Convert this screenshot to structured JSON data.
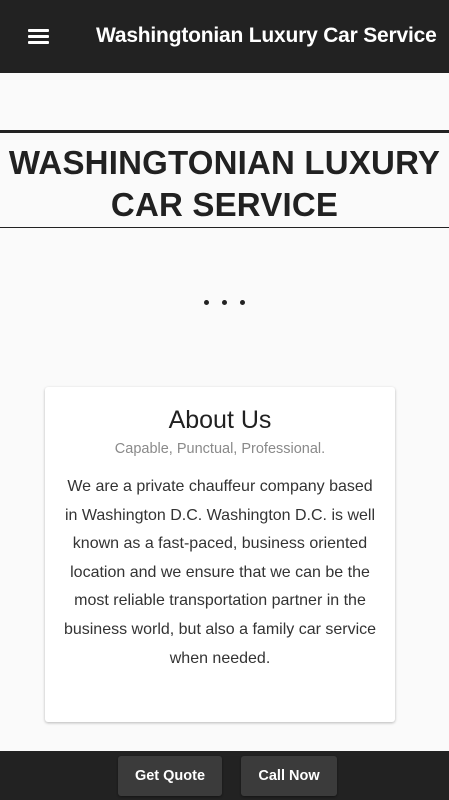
{
  "appbar": {
    "title": "Washingtonian Luxury Car Service",
    "menu_icon": "hamburger-menu-icon"
  },
  "hero": {
    "title": "WASHINGTONIAN LUXURY CAR SERVICE"
  },
  "carousel": {
    "indicator_icon": "more-dots-icon"
  },
  "about": {
    "title": "About Us",
    "subtitle": "Capable, Punctual, Professional.",
    "body": "We are a private chauffeur company based in Washington D.C. Washington D.C. is well known as a fast-paced, business oriented location and we ensure that we can be the most reliable transportation partner in the business world, but also a family car service when needed."
  },
  "bottom_bar": {
    "quote_label": "Get Quote",
    "call_label": "Call Now"
  },
  "colors": {
    "appbar_bg": "#222222",
    "page_bg": "#fafafa",
    "card_bg": "#ffffff",
    "button_bg": "#3b3b3b",
    "text_dark": "#212121",
    "text_muted": "#8a8a8a"
  }
}
